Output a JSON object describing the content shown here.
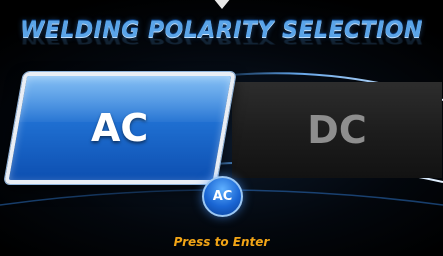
{
  "header": {
    "title": "WELDING POLARITY SELECTION"
  },
  "options": [
    {
      "label": "AC",
      "selected": true
    },
    {
      "label": "DC",
      "selected": false
    }
  ],
  "enter": {
    "button_label": "AC",
    "hint": "Press to Enter"
  },
  "colors": {
    "selected_fill": "#1f6fd1",
    "unselected_fill": "#1c1c1c",
    "title": "#5aa4e8",
    "hint": "#f2a516"
  },
  "icons": {
    "indicator": "triangle-down-icon"
  }
}
